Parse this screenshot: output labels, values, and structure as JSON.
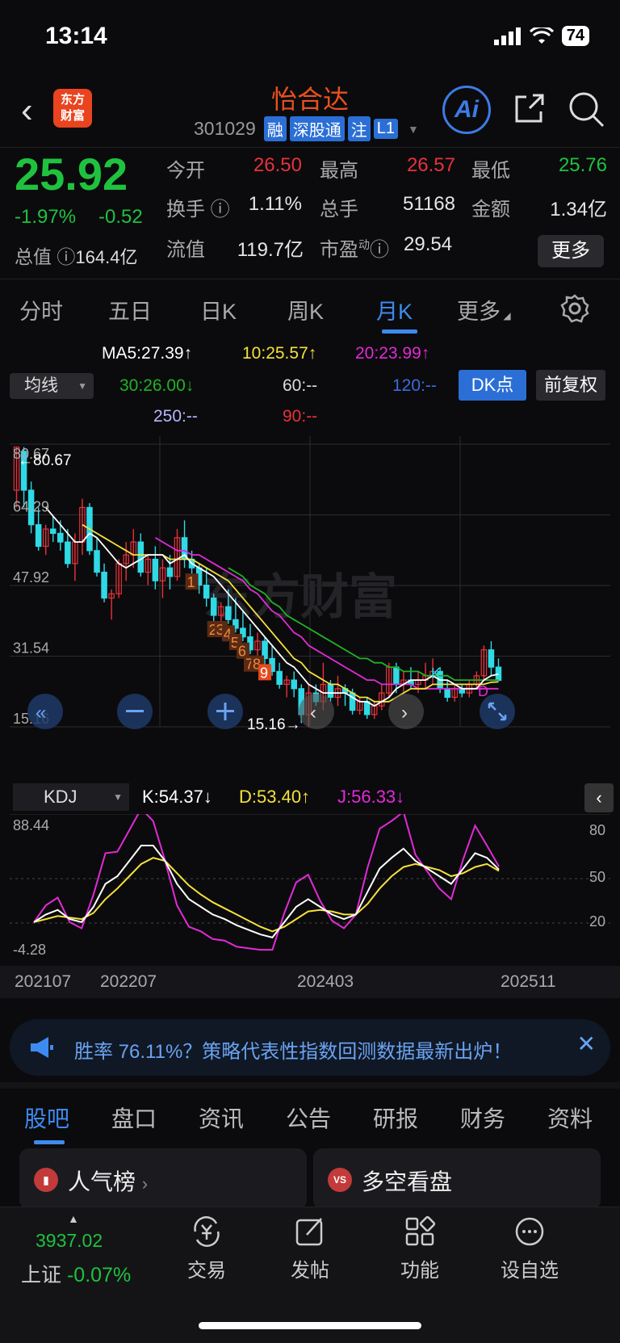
{
  "status": {
    "time": "13:14",
    "battery": "74"
  },
  "header": {
    "name": "怡合达",
    "code": "301029",
    "tags": [
      "融",
      "深股通",
      "注",
      "L1"
    ],
    "logo": [
      "东方",
      "财富"
    ],
    "ai_label": "Ai"
  },
  "quote": {
    "price": "25.92",
    "change_pct": "-1.97%",
    "change_abs": "-0.52",
    "total_value_label": "总值",
    "total_value": "164.4亿",
    "fields": [
      {
        "label": "今开",
        "value": "26.50",
        "color": "red"
      },
      {
        "label": "最高",
        "value": "26.57",
        "color": "red"
      },
      {
        "label": "最低",
        "value": "25.76",
        "color": "green"
      },
      {
        "label": "换手",
        "value": "1.11%",
        "color": "white"
      },
      {
        "label": "总手",
        "value": "51168",
        "color": "white"
      },
      {
        "label": "金额",
        "value": "1.34亿",
        "color": "white"
      },
      {
        "label": "流值",
        "value": "119.7亿",
        "color": "white"
      },
      {
        "label": "市盈",
        "value": "29.54",
        "color": "white"
      }
    ],
    "pe_super": "动",
    "more_label": "更多"
  },
  "tabs": [
    "分时",
    "五日",
    "日K",
    "周K",
    "月K",
    "更多"
  ],
  "active_tab": "月K",
  "ma_legend": {
    "ma5": "MA5:27.39↑",
    "ma10": "10:25.57↑",
    "ma20": "20:23.99↑",
    "ma30": "30:26.00↓",
    "ma60": "60:--",
    "ma120": "120:--",
    "ma250": "250:--",
    "ma90": "90:--",
    "line_select": "均线",
    "dk_label": "DK点",
    "fq_label": "前复权"
  },
  "kchart": {
    "y_labels": [
      "80.67",
      "64.29",
      "47.92",
      "31.54",
      "15.16"
    ],
    "max_marker": "←80.67",
    "min_marker": "15.16→",
    "watermark": "东方财富",
    "markers": [
      "1",
      "2",
      "3",
      "4",
      "5",
      "6",
      "7",
      "8",
      "9"
    ],
    "signals": [
      "K",
      "D"
    ]
  },
  "chart_data": {
    "type": "candlestick",
    "ylim": [
      15.16,
      80.67
    ],
    "candles": [
      [
        70,
        80,
        66,
        80
      ],
      [
        79,
        80,
        66,
        70
      ],
      [
        70,
        72,
        60,
        62
      ],
      [
        62,
        66,
        56,
        57
      ],
      [
        57,
        62,
        55,
        61
      ],
      [
        61,
        64,
        58,
        60
      ],
      [
        60,
        63,
        56,
        58
      ],
      [
        58,
        61,
        52,
        53
      ],
      [
        53,
        60,
        49,
        58
      ],
      [
        58,
        68,
        55,
        66
      ],
      [
        66,
        67,
        55,
        56
      ],
      [
        56,
        59,
        50,
        51
      ],
      [
        51,
        53,
        44,
        45
      ],
      [
        45,
        47,
        40,
        46
      ],
      [
        46,
        54,
        45,
        53
      ],
      [
        53,
        58,
        49,
        55
      ],
      [
        55,
        61,
        52,
        58
      ],
      [
        58,
        60,
        50,
        51
      ],
      [
        51,
        55,
        48,
        54
      ],
      [
        54,
        57,
        47,
        49
      ],
      [
        49,
        54,
        45,
        52
      ],
      [
        52,
        55,
        47,
        50
      ],
      [
        50,
        61,
        49,
        59
      ],
      [
        59,
        63,
        52,
        54
      ],
      [
        54,
        56,
        47,
        52
      ],
      [
        52,
        53,
        46,
        48
      ],
      [
        48,
        52,
        43,
        45
      ],
      [
        45,
        46,
        39,
        41
      ],
      [
        41,
        44,
        38,
        43
      ],
      [
        43,
        47,
        39,
        40
      ],
      [
        40,
        45,
        37,
        38
      ],
      [
        38,
        42,
        35,
        36
      ],
      [
        36,
        39,
        32,
        33
      ],
      [
        33,
        37,
        30,
        35
      ],
      [
        35,
        36,
        29,
        31
      ],
      [
        31,
        34,
        27,
        28
      ],
      [
        28,
        30,
        24,
        25
      ],
      [
        25,
        27,
        22,
        26
      ],
      [
        26,
        28,
        22,
        24
      ],
      [
        24,
        25,
        16,
        18
      ],
      [
        18,
        25,
        15.16,
        23
      ],
      [
        23,
        25,
        20,
        21
      ],
      [
        21,
        30,
        19,
        25
      ],
      [
        25,
        26,
        21,
        22
      ],
      [
        22,
        27,
        20,
        24
      ],
      [
        24,
        25,
        20,
        23
      ],
      [
        23,
        24,
        18,
        19
      ],
      [
        19,
        22,
        18,
        21
      ],
      [
        21,
        22,
        17,
        18
      ],
      [
        18,
        21,
        17,
        20
      ],
      [
        20,
        25,
        19,
        23
      ],
      [
        23,
        30,
        22,
        29
      ],
      [
        29,
        30,
        23,
        25
      ],
      [
        25,
        28,
        23,
        26
      ],
      [
        26,
        29,
        24,
        25
      ],
      [
        25,
        28,
        23,
        26
      ],
      [
        26,
        30,
        24,
        27
      ],
      [
        27,
        31,
        25,
        28
      ],
      [
        28,
        29,
        23,
        24
      ],
      [
        24,
        26,
        21,
        22
      ],
      [
        22,
        25,
        21,
        24
      ],
      [
        24,
        25,
        22,
        23
      ],
      [
        23,
        26,
        22,
        25
      ],
      [
        25,
        28,
        24,
        27
      ],
      [
        27,
        34,
        26,
        33
      ],
      [
        33,
        35,
        27,
        29
      ],
      [
        29,
        31,
        25.76,
        25.92
      ]
    ],
    "ma5": [
      null,
      null,
      null,
      null,
      66,
      64,
      62,
      60,
      58,
      58,
      60,
      59,
      57,
      55,
      53,
      52,
      53,
      54,
      55,
      55,
      55,
      53,
      54,
      55,
      53,
      52,
      51,
      50,
      48,
      46,
      44,
      42,
      40,
      38,
      36,
      34,
      32,
      30,
      29,
      27,
      25,
      24,
      23,
      23,
      23,
      23,
      22,
      21,
      21,
      20,
      21,
      22,
      24,
      25,
      26,
      26,
      26,
      27,
      26,
      26,
      25,
      24,
      24,
      24,
      26,
      27,
      27.39
    ],
    "ma10": [
      null,
      null,
      null,
      null,
      null,
      null,
      null,
      null,
      null,
      62,
      61,
      60,
      59,
      58,
      57,
      56,
      55,
      55,
      55,
      55,
      55,
      54,
      54,
      54,
      54,
      53,
      52,
      51,
      50,
      49,
      47,
      45,
      43,
      41,
      39,
      37,
      35,
      33,
      31,
      30,
      28,
      27,
      26,
      25,
      25,
      24,
      23,
      22,
      22,
      21,
      21,
      21,
      22,
      23,
      24,
      24,
      24,
      25,
      25,
      25,
      25,
      25,
      25,
      25,
      25,
      25.5,
      25.57
    ],
    "ma20": [
      null,
      null,
      null,
      null,
      null,
      null,
      null,
      null,
      null,
      null,
      null,
      null,
      null,
      null,
      null,
      null,
      null,
      null,
      null,
      59,
      58,
      57,
      56,
      56,
      55,
      55,
      54,
      53,
      52,
      51,
      50,
      49,
      47,
      46,
      44,
      42,
      41,
      39,
      37,
      36,
      34,
      33,
      32,
      31,
      30,
      29,
      28,
      27,
      26,
      26,
      25,
      25,
      25,
      25,
      25,
      24,
      24,
      24,
      24,
      24,
      24,
      24,
      24,
      24,
      24,
      24,
      23.99
    ],
    "ma30": [
      null,
      null,
      null,
      null,
      null,
      null,
      null,
      null,
      null,
      null,
      null,
      null,
      null,
      null,
      null,
      null,
      null,
      null,
      null,
      null,
      null,
      null,
      null,
      null,
      null,
      null,
      null,
      null,
      null,
      52,
      51,
      50,
      48,
      47,
      46,
      44,
      43,
      41,
      40,
      39,
      38,
      37,
      36,
      35,
      34,
      33,
      32,
      31,
      31,
      30,
      30,
      29,
      29,
      28,
      28,
      28,
      27,
      27,
      27,
      27,
      26,
      26,
      26,
      26,
      26,
      26,
      26.0
    ]
  },
  "kdj": {
    "select": "KDJ",
    "k_text": "K:54.37↓",
    "d_text": "D:53.40↑",
    "j_text": "J:56.33↓",
    "y_left": [
      "88.44",
      "-4.28"
    ],
    "y_right": [
      "80",
      "50",
      "20"
    ],
    "k": [
      20,
      25,
      28,
      22,
      20,
      30,
      45,
      50,
      60,
      70,
      70,
      60,
      45,
      35,
      30,
      25,
      22,
      18,
      15,
      12,
      10,
      20,
      30,
      35,
      30,
      25,
      22,
      25,
      40,
      55,
      62,
      68,
      60,
      55,
      50,
      45,
      55,
      65,
      62,
      54.37
    ],
    "d": [
      20,
      22,
      24,
      23,
      22,
      26,
      35,
      42,
      50,
      58,
      62,
      60,
      52,
      44,
      38,
      33,
      29,
      25,
      21,
      17,
      14,
      17,
      22,
      27,
      28,
      27,
      25,
      25,
      32,
      42,
      50,
      56,
      58,
      56,
      54,
      50,
      52,
      56,
      58,
      53.4
    ],
    "j": [
      20,
      31,
      36,
      20,
      16,
      38,
      65,
      66,
      80,
      94,
      86,
      60,
      31,
      17,
      14,
      9,
      8,
      4,
      3,
      2,
      2,
      26,
      46,
      51,
      34,
      21,
      16,
      25,
      56,
      81,
      86,
      92,
      64,
      53,
      42,
      35,
      61,
      83,
      70,
      56.33
    ]
  },
  "x_axis": [
    "202107",
    "202207",
    "202403",
    "202511"
  ],
  "banner": {
    "text": "胜率 76.11%？策略代表性指数回测数据最新出炉！"
  },
  "sub_tabs": [
    "股吧",
    "盘口",
    "资讯",
    "公告",
    "研报",
    "财务",
    "资料"
  ],
  "cards": [
    {
      "title": "人气榜",
      "icon": "bar-chart-icon"
    },
    {
      "title": "多空看盘",
      "icon": "vs-icon"
    }
  ],
  "bottom": {
    "index_value": "3937.02",
    "index_name": "上证",
    "index_change": "-0.07%",
    "items": [
      "交易",
      "发帖",
      "功能",
      "设自选"
    ]
  },
  "colors": {
    "up": "#e8323a",
    "down": "#1fc23e",
    "candle_down": "#2fd9e6",
    "ma5": "#ffffff",
    "ma10": "#f5e13c",
    "ma20": "#e22ad6",
    "ma30": "#1fb324",
    "accent": "#3d8bf0"
  }
}
